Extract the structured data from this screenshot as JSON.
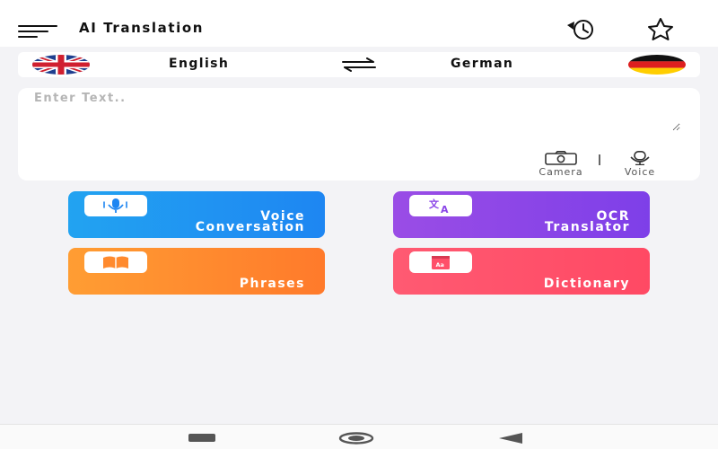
{
  "header": {
    "title": "AI Translation",
    "menu_icon": "hamburger-menu-icon",
    "history_icon": "history-clock-icon",
    "favorite_icon": "star-icon"
  },
  "language_bar": {
    "source_language": "English",
    "target_language": "German",
    "source_flag": "uk-flag-icon",
    "target_flag": "germany-flag-icon",
    "swap_icon": "swap-arrows-icon"
  },
  "input": {
    "placeholder": "Enter Text..",
    "value": "",
    "tools": [
      {
        "label": "Camera",
        "icon": "camera-icon"
      },
      {
        "label": "Voice",
        "icon": "microphone-icon"
      }
    ]
  },
  "features": [
    {
      "label": "Voice\nConversation",
      "icon": "microphone-icon",
      "color": "#1e86f2"
    },
    {
      "label": "OCR\nTranslator",
      "icon": "translate-icon",
      "color": "#8a45e7"
    },
    {
      "label": "Phrases",
      "icon": "book-icon",
      "color": "#ff8a2e"
    },
    {
      "label": "Dictionary",
      "icon": "dictionary-icon",
      "color": "#ff4f69"
    }
  ],
  "colors": {
    "background": "#f3f3f6",
    "surface": "#ffffff"
  },
  "system_nav": {
    "recents_icon": "recents-icon",
    "home_icon": "home-icon",
    "back_icon": "back-triangle-icon"
  }
}
